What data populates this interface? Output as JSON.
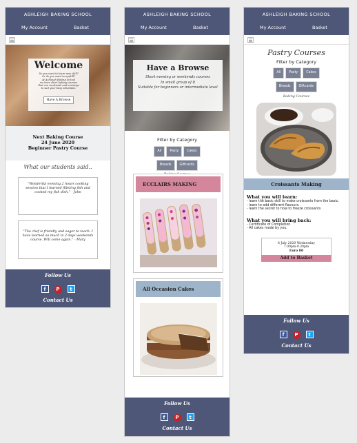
{
  "site_title": "ASHLEIGH BAKING SCHOOL",
  "nav": {
    "account": "My Account",
    "basket": "Basket"
  },
  "footer": {
    "follow": "Follow Us",
    "contact": "Contact Us",
    "icons": [
      "facebook-icon",
      "pinterest-icon",
      "twitter-icon"
    ]
  },
  "colors": {
    "header": "#4e5777",
    "chip": "#7b8194",
    "eclairs_bar": "#d4879c",
    "cakes_bar": "#9db4cb",
    "add_button": "#d4879c"
  },
  "screen1": {
    "hero_title": "Welcome",
    "hero_text": [
      "Do you want to learn new skill?",
      "Or do you want to upskill?",
      "At Ashleigh Baking School",
      "we have short baking courses",
      "that run weekends and evenings",
      "to suit your busy schedules."
    ],
    "hero_button": "Have A Browse",
    "next_course": [
      "Next Baking Course",
      "24 June 2020",
      "Beginner Pastry Course"
    ],
    "students_heading": "What our students said..",
    "testimonials": [
      "“Wonderful evening 2 hours cooking session that I learned filleting fish and cooked my fish dish.” - John",
      "“The chef is friendly and eager to teach. I have learned so much in 2 days weekends course. Will come again.” - Mary"
    ]
  },
  "screen2": {
    "hero_title": "Have a Browse",
    "hero_lines": [
      "Short evening or weekends courses",
      "In small group of 8",
      "Suitable for beginners or intermediate level"
    ],
    "filter_label": "Filter by Category",
    "chips_row1": [
      "All",
      "Pasty",
      "Cakes"
    ],
    "chips_row2": [
      "Breads",
      "Giftcards"
    ],
    "category_label": "Baking Courses",
    "cards": [
      "ECCLAIRS MAKING",
      "All Occasion Cakes"
    ]
  },
  "screen3": {
    "page_title": "Pastry Courses",
    "filter_label": "Filter by Category",
    "chips_row1": [
      "All",
      "Pasty",
      "Cakes"
    ],
    "chips_row2": [
      "Breads",
      "Giftcards"
    ],
    "category_label": "Baking Courses",
    "course_name": "Croissants Making",
    "learn_heading": "What you will learn:",
    "learn_items": [
      "- learn the basic skill to make croissants from the basic.",
      "- learn to add different flavours.",
      "- learn the secret to how to freeze croissants"
    ],
    "bring_heading": "What you will bring back:",
    "bring_items": [
      "- Certificate of Completion",
      "- All cakes made by you."
    ],
    "date_line": "8 July 2020 Wednesday",
    "time_line": "7.00pm-9.30pm",
    "price": "Euro 80",
    "add_button": "Add to Basket"
  }
}
